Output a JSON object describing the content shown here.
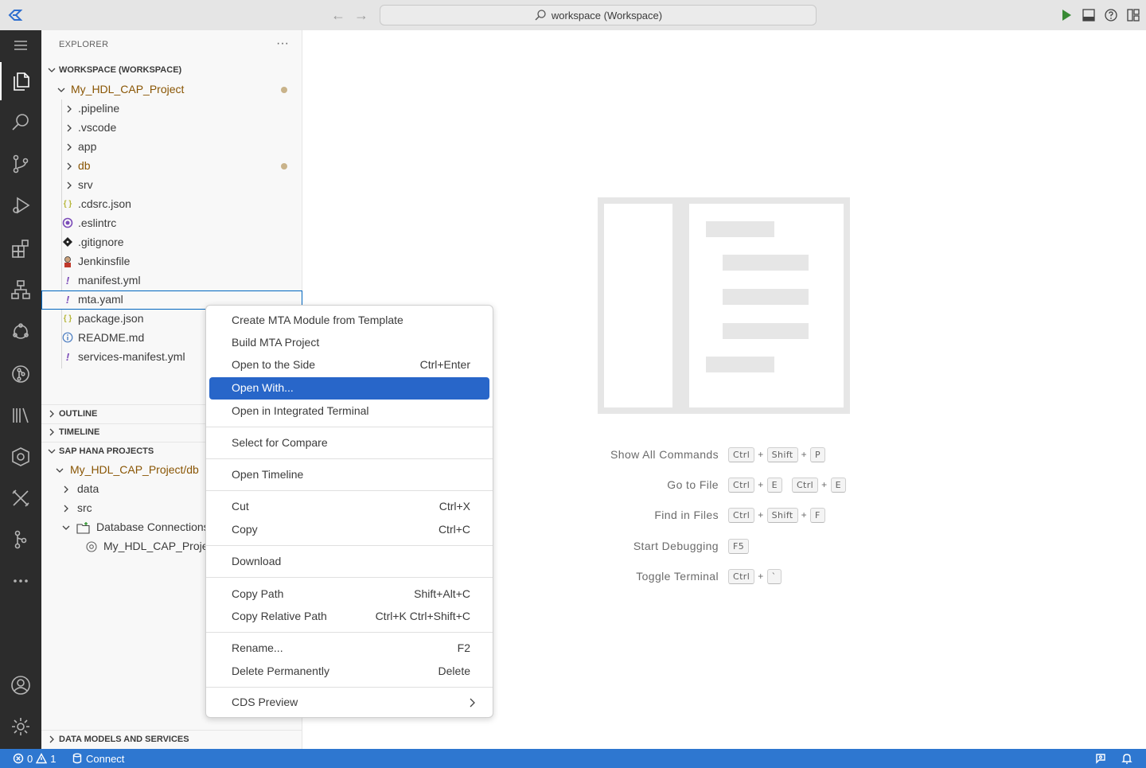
{
  "titlebar": {
    "search_text": "workspace (Workspace)"
  },
  "explorer": {
    "title": "EXPLORER",
    "more": "···",
    "workspace_header": "WORKSPACE (WORKSPACE)",
    "items": [
      {
        "label": "My_HDL_CAP_Project",
        "type": "folder-open",
        "modified": true
      },
      {
        "label": ".pipeline",
        "type": "folder"
      },
      {
        "label": ".vscode",
        "type": "folder"
      },
      {
        "label": "app",
        "type": "folder"
      },
      {
        "label": "db",
        "type": "folder",
        "modified": true
      },
      {
        "label": "srv",
        "type": "folder"
      },
      {
        "label": ".cdsrc.json",
        "type": "json-file",
        "icon": "{ }"
      },
      {
        "label": ".eslintrc",
        "type": "eslint-file"
      },
      {
        "label": ".gitignore",
        "type": "git-file"
      },
      {
        "label": "Jenkinsfile",
        "type": "jenkins-file"
      },
      {
        "label": "manifest.yml",
        "type": "yaml-file",
        "icon": "!"
      },
      {
        "label": "mta.yaml",
        "type": "yaml-file",
        "icon": "!",
        "selected": true
      },
      {
        "label": "package.json",
        "type": "json-file",
        "icon": "{ }"
      },
      {
        "label": "README.md",
        "type": "info-file"
      },
      {
        "label": "services-manifest.yml",
        "type": "yaml-file",
        "icon": "!"
      }
    ]
  },
  "sections": {
    "outline": "OUTLINE",
    "timeline": "TIMELINE",
    "sap_hana": "SAP HANA PROJECTS",
    "data_models": "DATA MODELS AND SERVICES"
  },
  "hana_tree": [
    {
      "label": "My_HDL_CAP_Project/db"
    },
    {
      "label": "data"
    },
    {
      "label": "src"
    },
    {
      "label": "Database Connections"
    },
    {
      "label": "My_HDL_CAP_Project"
    }
  ],
  "context_menu": {
    "groups": [
      [
        {
          "label": "Create MTA Module from Template",
          "key": ""
        },
        {
          "label": "Build MTA Project",
          "key": ""
        },
        {
          "label": "Open to the Side",
          "key": "Ctrl+Enter"
        },
        {
          "label": "Open With...",
          "key": "",
          "highlighted": true
        },
        {
          "label": "Open in Integrated Terminal",
          "key": ""
        }
      ],
      [
        {
          "label": "Select for Compare",
          "key": ""
        }
      ],
      [
        {
          "label": "Open Timeline",
          "key": ""
        }
      ],
      [
        {
          "label": "Cut",
          "key": "Ctrl+X"
        },
        {
          "label": "Copy",
          "key": "Ctrl+C"
        }
      ],
      [
        {
          "label": "Download",
          "key": ""
        }
      ],
      [
        {
          "label": "Copy Path",
          "key": "Shift+Alt+C"
        },
        {
          "label": "Copy Relative Path",
          "key": "Ctrl+K Ctrl+Shift+C"
        }
      ],
      [
        {
          "label": "Rename...",
          "key": "F2"
        },
        {
          "label": "Delete Permanently",
          "key": "Delete"
        }
      ],
      [
        {
          "label": "CDS Preview",
          "key": "",
          "submenu": true
        }
      ]
    ]
  },
  "shortcuts": [
    {
      "label": "Show All Commands",
      "keys": [
        [
          "Ctrl",
          "Shift",
          "P"
        ]
      ]
    },
    {
      "label": "Go to File",
      "keys": [
        [
          "Ctrl",
          "E"
        ],
        [
          "Ctrl",
          "E"
        ]
      ]
    },
    {
      "label": "Find in Files",
      "keys": [
        [
          "Ctrl",
          "Shift",
          "F"
        ]
      ]
    },
    {
      "label": "Start Debugging",
      "keys": [
        [
          "F5"
        ]
      ]
    },
    {
      "label": "Toggle Terminal",
      "keys": [
        [
          "Ctrl",
          "`"
        ]
      ]
    }
  ],
  "statusbar": {
    "errors": "0",
    "warnings": "1",
    "connect": "Connect"
  },
  "colors": {
    "statusbar": "#2e77d0",
    "menu_highlight": "#2866c9",
    "activitybar": "#2c2c2c",
    "modified": "#895503",
    "run_green": "#388a34"
  }
}
